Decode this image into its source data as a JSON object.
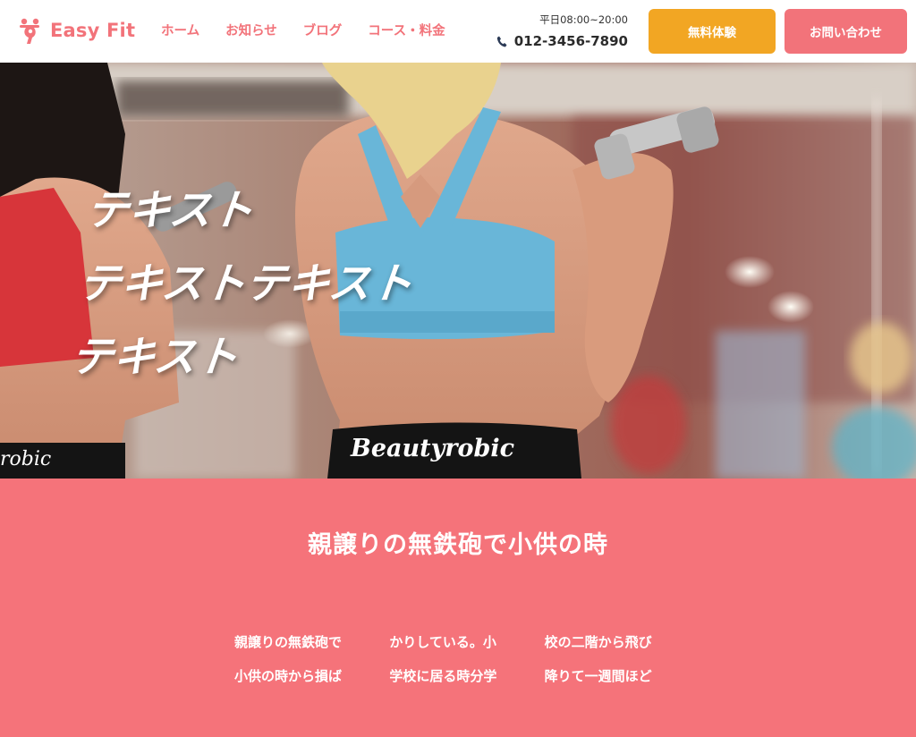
{
  "header": {
    "logo_text": "Easy Fit",
    "nav": [
      "ホーム",
      "お知らせ",
      "ブログ",
      "コース・料金"
    ],
    "hours": "平日08:00~20:00",
    "phone": "012-3456-7890",
    "trial_button": "無料体験",
    "contact_button": "お問い合わせ"
  },
  "hero": {
    "heading_lines": [
      "テキスト",
      "テキストテキスト",
      "テキスト"
    ],
    "shorts_brand": "Beautyrobic"
  },
  "section": {
    "title": "親譲りの無鉄砲で小供の時",
    "columns": [
      [
        "親譲りの無鉄砲で",
        "小供の時から損ば"
      ],
      [
        "かりしている。小",
        "学校に居る時分学"
      ],
      [
        "校の二階から飛び",
        "降りて一週間ほど"
      ]
    ]
  },
  "colors": {
    "brand_pink": "#f2737a",
    "section_pink": "#f5737a",
    "trial_orange": "#f2a623",
    "top_blue": "#69b6d8"
  },
  "icons": {
    "logo": "dumbbell-woman-logo-icon",
    "phone": "phone-icon"
  }
}
